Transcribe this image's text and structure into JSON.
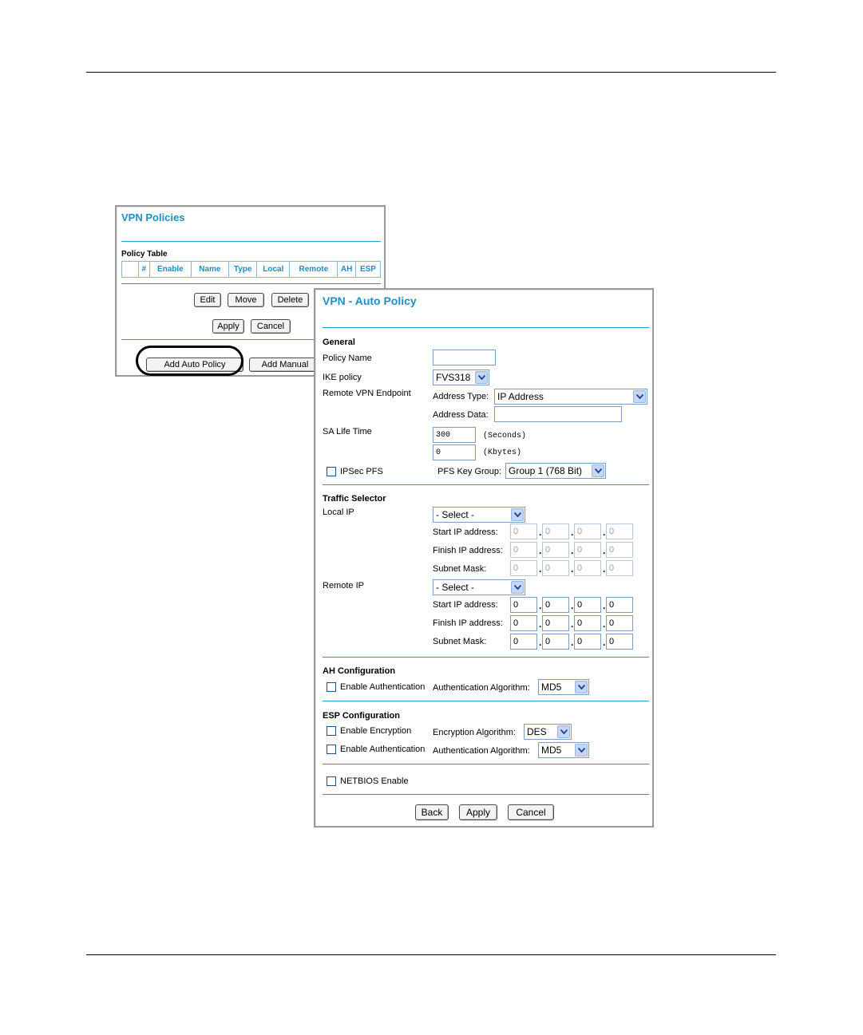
{
  "vpn_policies": {
    "title": "VPN Policies",
    "table_label": "Policy Table",
    "columns": [
      "",
      "#",
      "Enable",
      "Name",
      "Type",
      "Local",
      "Remote",
      "AH",
      "ESP"
    ],
    "buttons": {
      "edit": "Edit",
      "move": "Move",
      "delete": "Delete",
      "apply": "Apply",
      "cancel": "Cancel",
      "add_auto": "Add Auto Policy",
      "add_manual": "Add Manual"
    }
  },
  "auto_policy": {
    "title": "VPN - Auto Policy",
    "general": {
      "heading": "General",
      "policy_name_label": "Policy Name",
      "policy_name_value": "",
      "ike_policy_label": "IKE policy",
      "ike_policy_value": "FVS318",
      "remote_endpoint_label": "Remote VPN Endpoint",
      "address_type_label": "Address Type:",
      "address_type_value": "IP Address",
      "address_data_label": "Address Data:",
      "address_data_value": "",
      "sa_lifetime_label": "SA Life Time",
      "sa_seconds_value": "300",
      "sa_seconds_unit": "(Seconds)",
      "sa_kbytes_value": "0",
      "sa_kbytes_unit": "(Kbytes)",
      "ipsec_pfs_label": "IPSec PFS",
      "pfs_key_group_label": "PFS Key Group:",
      "pfs_key_group_value": "Group 1 (768 Bit)"
    },
    "traffic": {
      "heading": "Traffic Selector",
      "local_ip_label": "Local IP",
      "local_select": "- Select -",
      "remote_ip_label": "Remote IP",
      "remote_select": "- Select -",
      "start_label": "Start IP address:",
      "finish_label": "Finish IP address:",
      "mask_label": "Subnet Mask:",
      "octet": "0"
    },
    "ah": {
      "heading": "AH Configuration",
      "enable_auth_label": "Enable Authentication",
      "auth_alg_label": "Authentication Algorithm:",
      "auth_alg_value": "MD5"
    },
    "esp": {
      "heading": "ESP Configuration",
      "enable_enc_label": "Enable Encryption",
      "enc_alg_label": "Encryption Algorithm:",
      "enc_alg_value": "DES",
      "enable_auth_label": "Enable Authentication",
      "auth_alg_label": "Authentication Algorithm:",
      "auth_alg_value": "MD5"
    },
    "netbios_label": "NETBIOS Enable",
    "buttons": {
      "back": "Back",
      "apply": "Apply",
      "cancel": "Cancel"
    }
  },
  "colors": {
    "accent": "#1b8fc7",
    "separator": "#2a97c9",
    "panel_border": "#9a9a9a"
  }
}
